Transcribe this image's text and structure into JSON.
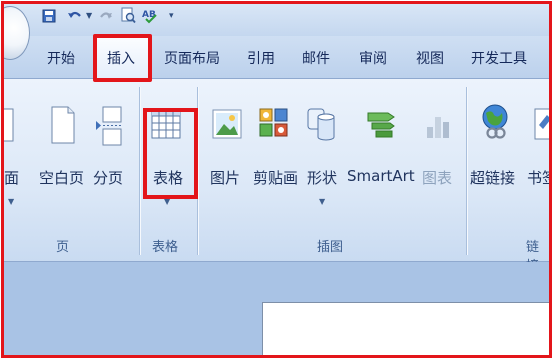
{
  "tabs": [
    {
      "id": "home",
      "label": "开始"
    },
    {
      "id": "insert",
      "label": "插入"
    },
    {
      "id": "page-layout",
      "label": "页面布局"
    },
    {
      "id": "references",
      "label": "引用"
    },
    {
      "id": "mailings",
      "label": "邮件"
    },
    {
      "id": "review",
      "label": "审阅"
    },
    {
      "id": "view",
      "label": "视图"
    },
    {
      "id": "developer",
      "label": "开发工具"
    }
  ],
  "active_tab": "插入",
  "commands": {
    "cover_page": "面",
    "blank_page": "空白页",
    "page_break": "分页",
    "table": "表格",
    "picture": "图片",
    "clip_art": "剪贴画",
    "shapes": "形状",
    "smartart": "SmartArt",
    "chart": "图表",
    "hyperlink": "超链接",
    "bookmark": "书签"
  },
  "groups": {
    "pages": "页",
    "tables": "表格",
    "illustrations": "插图",
    "links": "链接"
  },
  "colors": {
    "highlight": "#e3151a",
    "ribbon_bg": "#dce8f7",
    "tab_text": "#15295a"
  },
  "icons": [
    "save-icon",
    "undo-icon",
    "redo-icon",
    "print-preview-icon",
    "spelling-icon",
    "customize-arrow-icon",
    "page-icon",
    "page-break-icon",
    "table-icon",
    "picture-icon",
    "clip-art-icon",
    "shapes-icon",
    "smartart-icon",
    "chart-icon",
    "hyperlink-icon",
    "bookmark-icon"
  ]
}
